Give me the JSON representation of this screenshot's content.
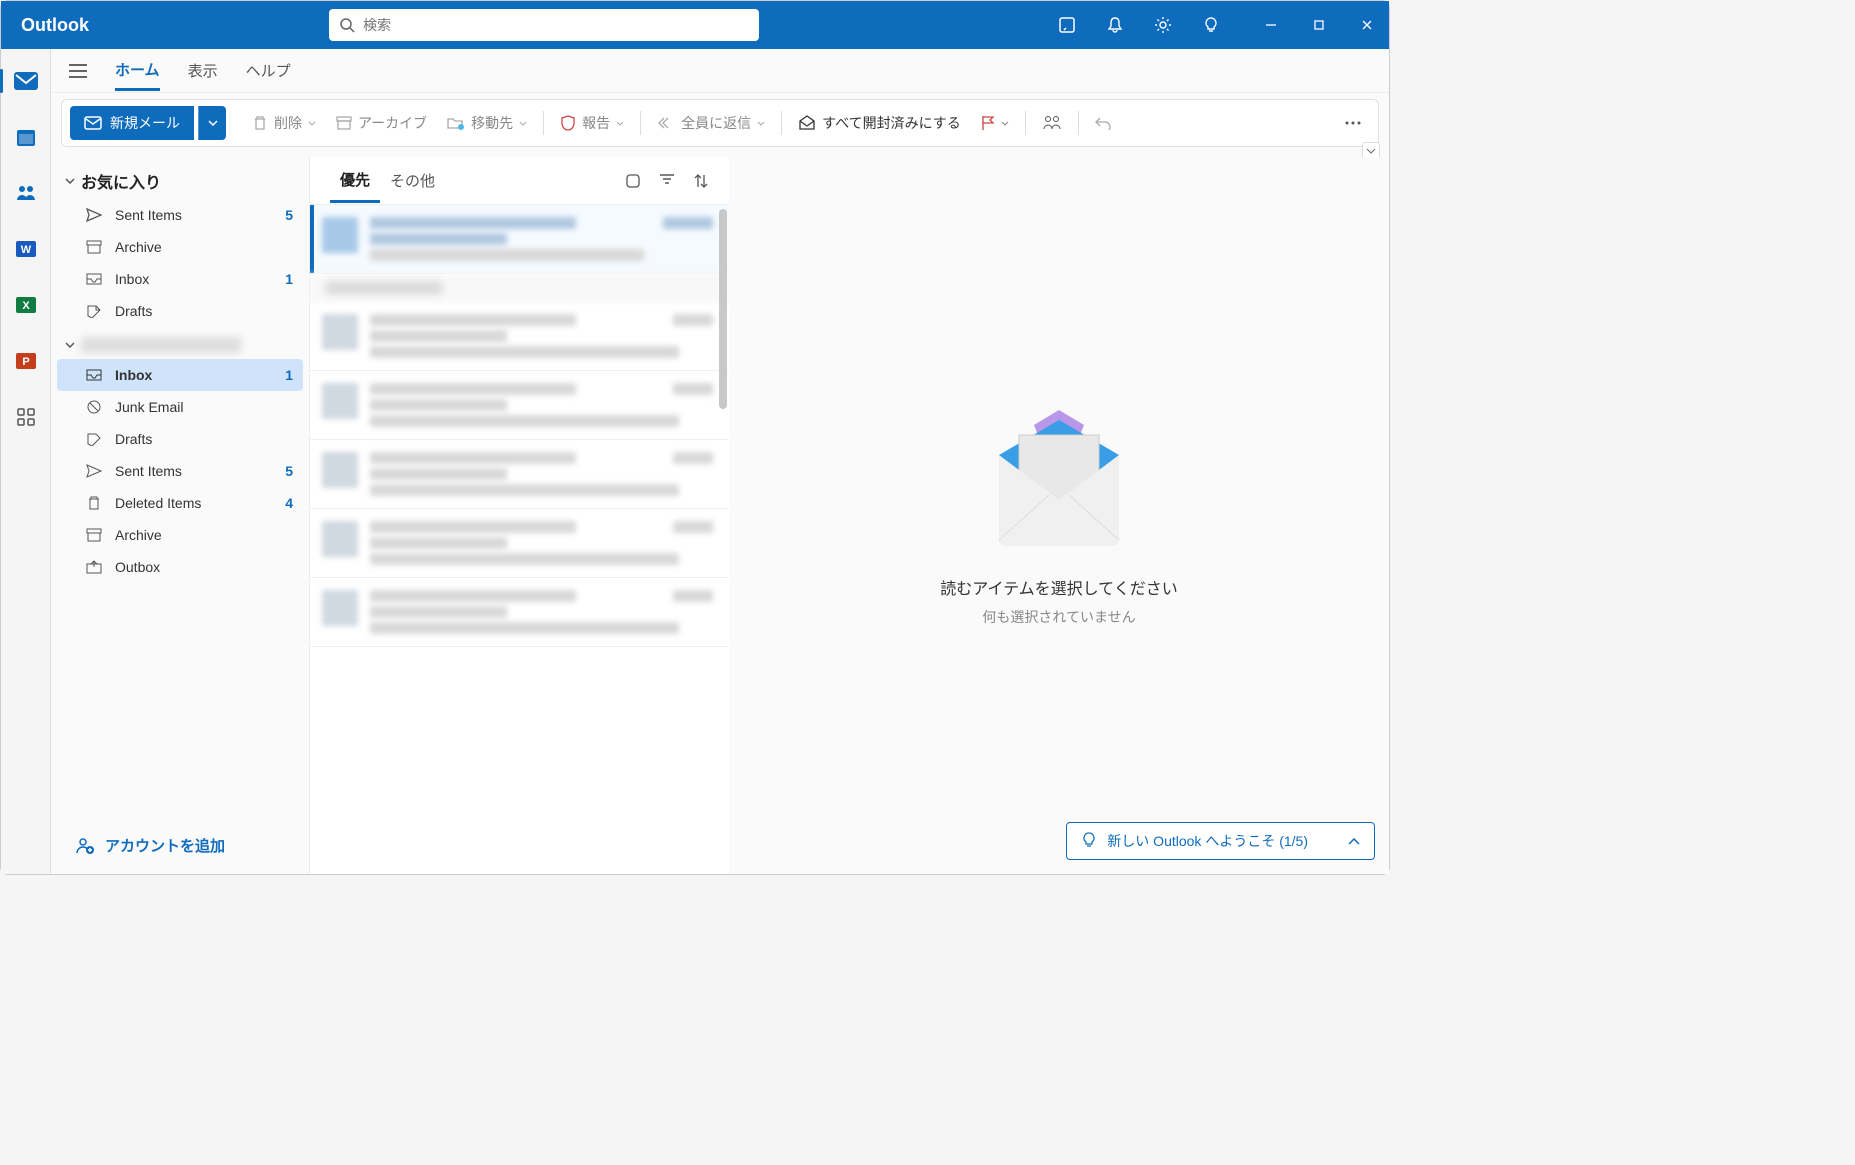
{
  "app": {
    "title": "Outlook"
  },
  "search": {
    "placeholder": "検索"
  },
  "tabs": {
    "home": "ホーム",
    "view": "表示",
    "help": "ヘルプ"
  },
  "ribbon": {
    "new_mail": "新規メール",
    "delete": "削除",
    "archive": "アーカイブ",
    "move": "移動先",
    "report": "報告",
    "reply_all": "全員に返信",
    "mark_read": "すべて開封済みにする"
  },
  "folders": {
    "favorites_header": "お気に入り",
    "fav": [
      {
        "name": "Sent Items",
        "count": "5",
        "icon": "send"
      },
      {
        "name": "Archive",
        "count": "",
        "icon": "archive"
      },
      {
        "name": "Inbox",
        "count": "1",
        "icon": "inbox"
      },
      {
        "name": "Drafts",
        "count": "",
        "icon": "draft"
      }
    ],
    "account": [
      {
        "name": "Inbox",
        "count": "1",
        "icon": "inbox2",
        "selected": true
      },
      {
        "name": "Junk Email",
        "count": "",
        "icon": "junk"
      },
      {
        "name": "Drafts",
        "count": "",
        "icon": "draft"
      },
      {
        "name": "Sent Items",
        "count": "5",
        "icon": "send"
      },
      {
        "name": "Deleted Items",
        "count": "4",
        "icon": "trash"
      },
      {
        "name": "Archive",
        "count": "",
        "icon": "archive"
      },
      {
        "name": "Outbox",
        "count": "",
        "icon": "outbox"
      }
    ],
    "add_account": "アカウントを追加"
  },
  "msglist": {
    "focused": "優先",
    "other": "その他"
  },
  "reading": {
    "title": "読むアイテムを選択してください",
    "sub": "何も選択されていません"
  },
  "welcome": {
    "text": "新しい Outlook へようこそ  (1/5)"
  }
}
